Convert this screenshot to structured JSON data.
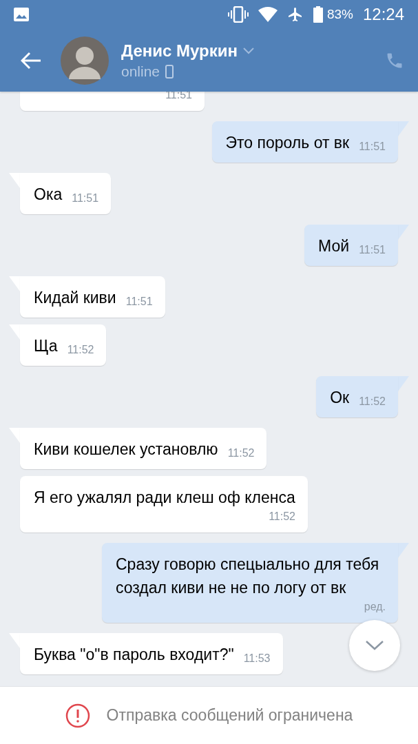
{
  "status_bar": {
    "battery": "83%",
    "time": "12:24"
  },
  "header": {
    "name": "Денис Муркин",
    "status": "online"
  },
  "messages": [
    {
      "kind": "incoming",
      "time": "11:51"
    },
    {
      "kind": "outgoing",
      "text": "Это пороль от вк",
      "time": "11:51",
      "tail": true
    },
    {
      "kind": "incoming",
      "text": "Ока",
      "time": "11:51",
      "tail": true
    },
    {
      "kind": "outgoing",
      "text": "Мой",
      "time": "11:51",
      "tail": true
    },
    {
      "kind": "incoming",
      "text": "Кидай киви",
      "time": "11:51",
      "tail": true
    },
    {
      "kind": "incoming",
      "text": "Ща",
      "time": "11:52",
      "tail": true
    },
    {
      "kind": "outgoing",
      "text": "Ок",
      "time": "11:52",
      "tail": true
    },
    {
      "kind": "incoming",
      "text": "Киви кошелек установлю",
      "time": "11:52",
      "tail": true
    },
    {
      "kind": "incoming",
      "text": "Я его ужалял ради клеш оф кленса",
      "time": "11:52",
      "tail": false
    },
    {
      "kind": "outgoing",
      "text": "Сразу говорю спецыально для тебя создал киви не не по логу от вк",
      "time": "ред.",
      "tail": true
    },
    {
      "kind": "incoming",
      "text": "Буква \"о\"в пароль входит?\"",
      "time": "11:53",
      "tail": true
    }
  ],
  "notice": "Отправка сообщений ограничена"
}
